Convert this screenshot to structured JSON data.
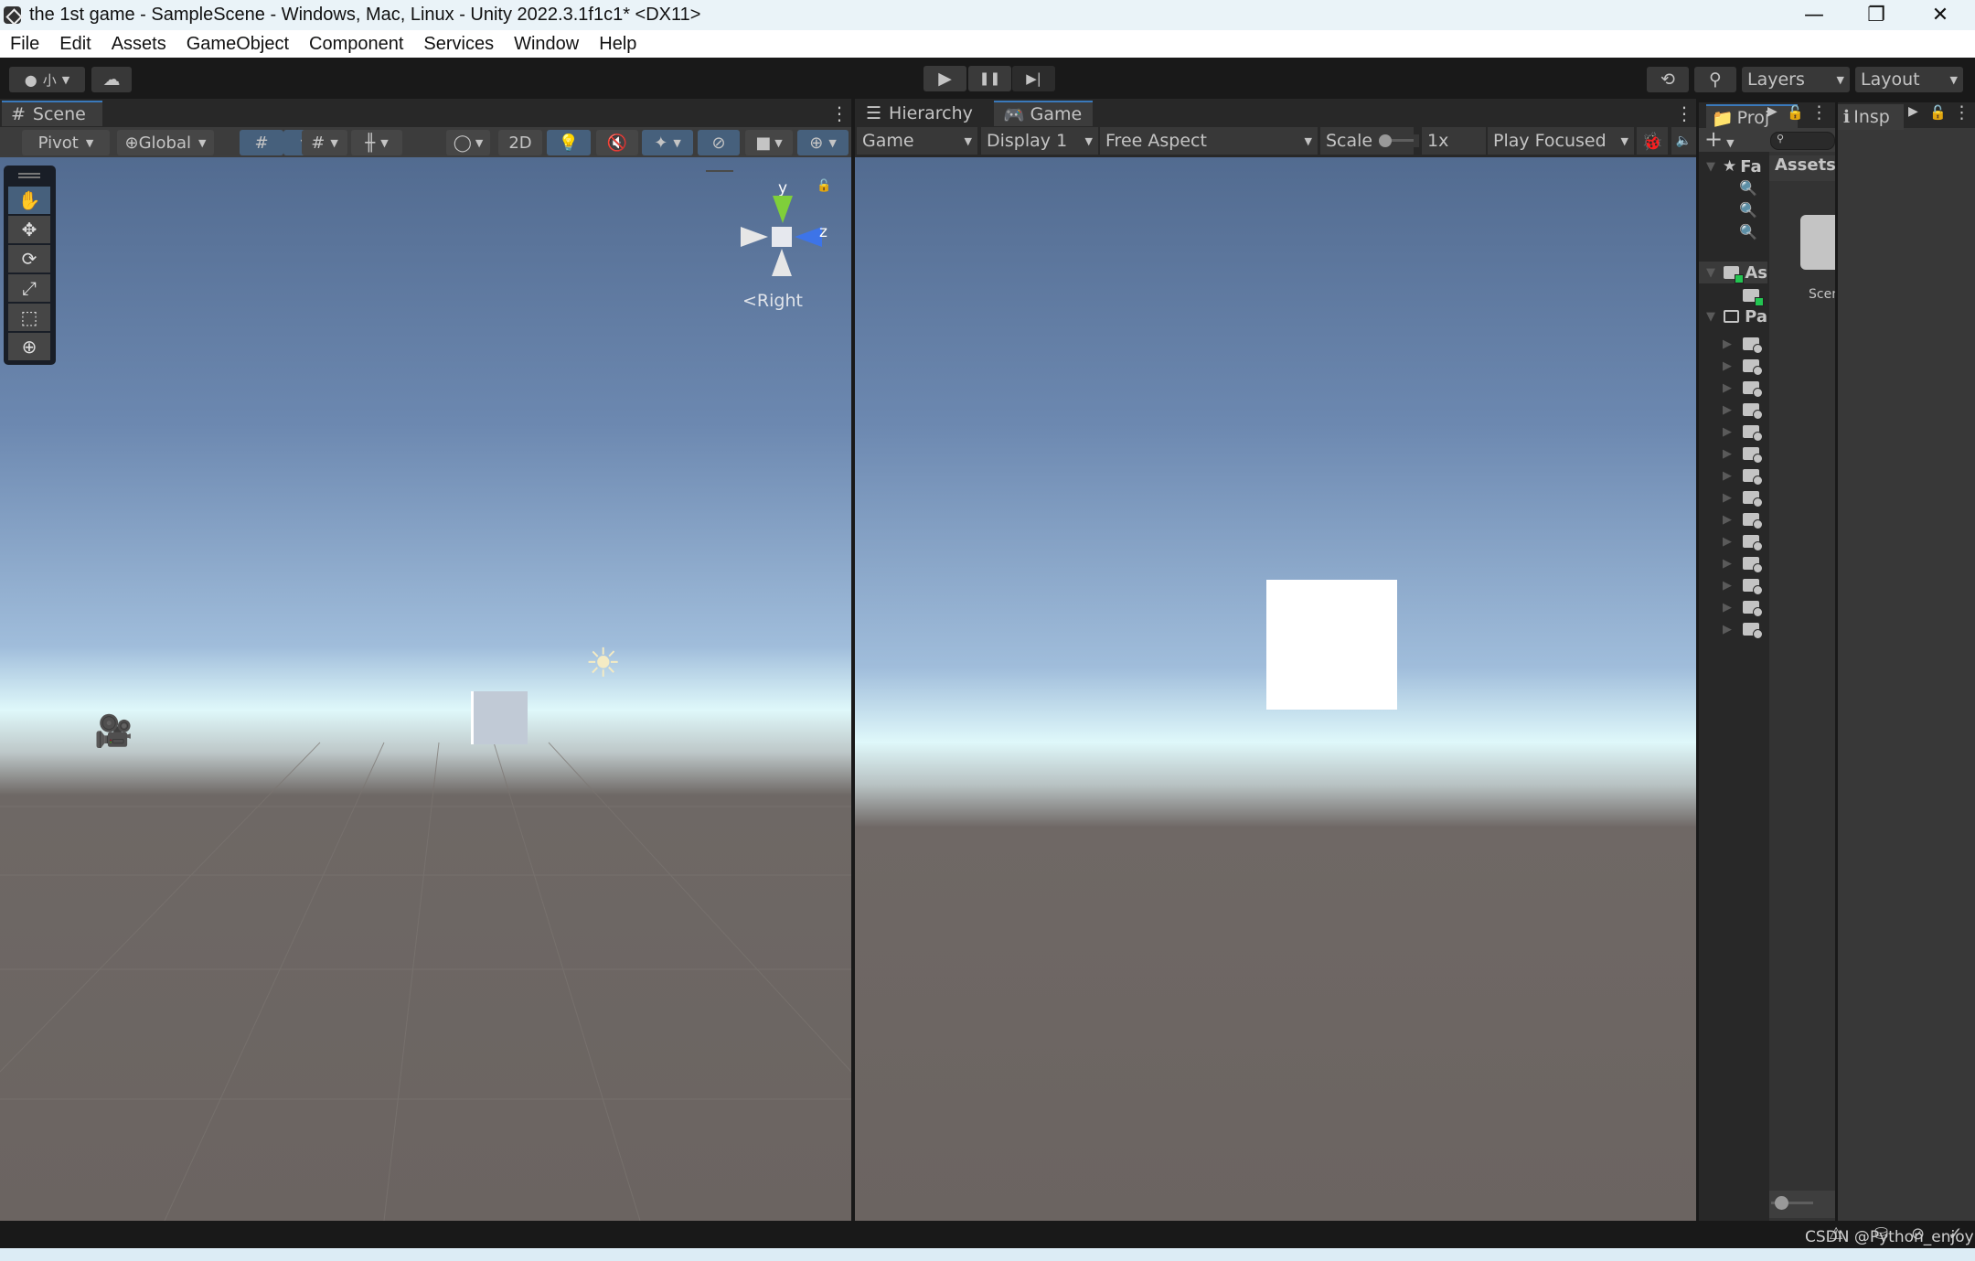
{
  "window": {
    "title": "the 1st game - SampleScene - Windows, Mac, Linux - Unity 2022.3.1f1c1* <DX11>",
    "controls": {
      "minimize": "—",
      "maximize": "❐",
      "close": "✕"
    }
  },
  "menu": [
    "File",
    "Edit",
    "Assets",
    "GameObject",
    "Component",
    "Services",
    "Window",
    "Help"
  ],
  "toolbar": {
    "account_label": "小",
    "play_icon": "▶",
    "pause_icon": "❚❚",
    "step_icon": "▶|",
    "history_icon": "⟲",
    "search_icon": "⚲",
    "layers_label": "Layers",
    "layout_label": "Layout"
  },
  "scene": {
    "tab_label": "Scene",
    "pivot_label": "Pivot",
    "global_label": "Global",
    "two_d_label": "2D",
    "gizmo_axis_y": "y",
    "gizmo_axis_z": "z",
    "gizmo_view_label": "Right",
    "tools": [
      "hand",
      "move",
      "rotate",
      "scale",
      "rect",
      "transform"
    ]
  },
  "game": {
    "hierarchy_tab": "Hierarchy",
    "game_tab": "Game",
    "mode_label": "Game",
    "display_label": "Display 1",
    "aspect_label": "Free Aspect",
    "scale_label": "Scale",
    "scale_value": "1x",
    "scale_slider_fraction": 0,
    "play_mode_label": "Play Focused"
  },
  "project": {
    "tab_label": "Proj",
    "favorites_label": "Fa",
    "assets_label": "As",
    "packages_label": "Pa",
    "breadcrumb": "Assets",
    "asset_item": "Scen",
    "package_folder_count": 14,
    "packages": [
      "",
      "",
      "",
      "",
      "",
      "",
      "",
      "",
      "",
      "",
      "",
      "",
      "",
      ""
    ]
  },
  "inspector": {
    "tab_label": "Insp"
  },
  "watermark": "CSDN @Python_enjoy"
}
